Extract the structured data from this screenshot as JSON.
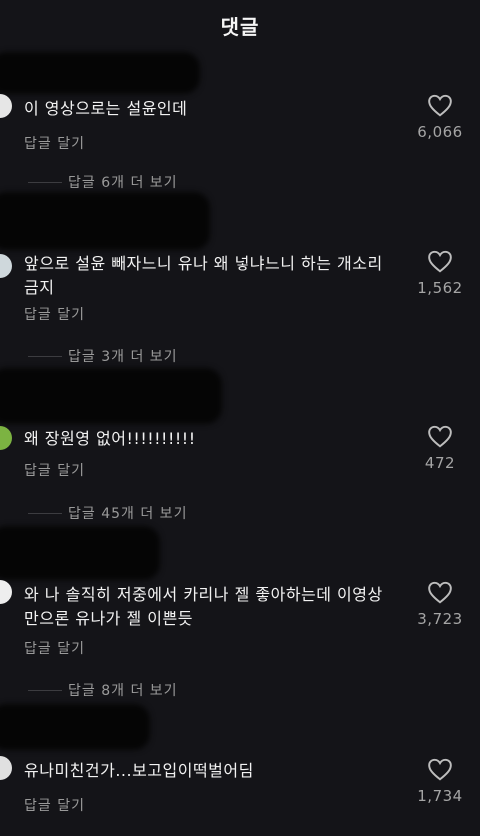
{
  "header": {
    "title": "댓글"
  },
  "comments": [
    {
      "text": "이 영상으로는 설윤인데",
      "reply_label": "답글 달기",
      "likes": "6,066",
      "view_more": "답글 6개 더 보기",
      "avatar_color": "#e6e6e6"
    },
    {
      "text": "앞으로 설윤 빼자느니 유나 왜 넣냐느니 하는 개소리 금지",
      "reply_label": "답글 달기",
      "likes": "1,562",
      "view_more": "답글 3개 더 보기",
      "avatar_color": "#cfd8dc"
    },
    {
      "text": "왜 장원영 없어!!!!!!!!!!",
      "reply_label": "답글 달기",
      "likes": "472",
      "view_more": "답글 45개 더 보기",
      "avatar_color": "#7cb342"
    },
    {
      "text": "와 나 솔직히 저중에서 카리나 젤 좋아하는데 이영상만으론 유나가 젤 이쁜듯",
      "reply_label": "답글 달기",
      "likes": "3,723",
      "view_more": "답글 8개 더 보기",
      "avatar_color": "#eeeeee"
    },
    {
      "text": "유나미친건가...보고입이떡벌어딤",
      "reply_label": "답글 달기",
      "likes": "1,734",
      "avatar_color": "#e0e0e0"
    }
  ]
}
